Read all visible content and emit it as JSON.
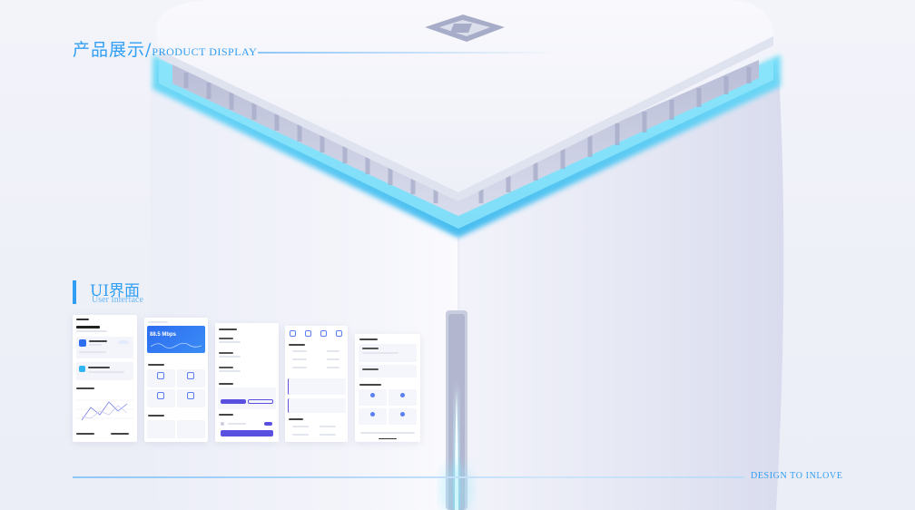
{
  "header": {
    "title_cn": "产品展示",
    "slash": "/",
    "title_en": "PRODUCT DISPLAY"
  },
  "ui_section": {
    "title_cn": "UI界面",
    "title_en": "User Interface"
  },
  "footer": {
    "text": "DESIGN TO INLOVE"
  },
  "screens": {
    "speed_value": "88.5 Mbps"
  },
  "colors": {
    "accent": "#2f9ef4",
    "glow": "#5fd2f6",
    "primary_purple": "#5b4fe0",
    "card_blue": "#2d6df0"
  }
}
